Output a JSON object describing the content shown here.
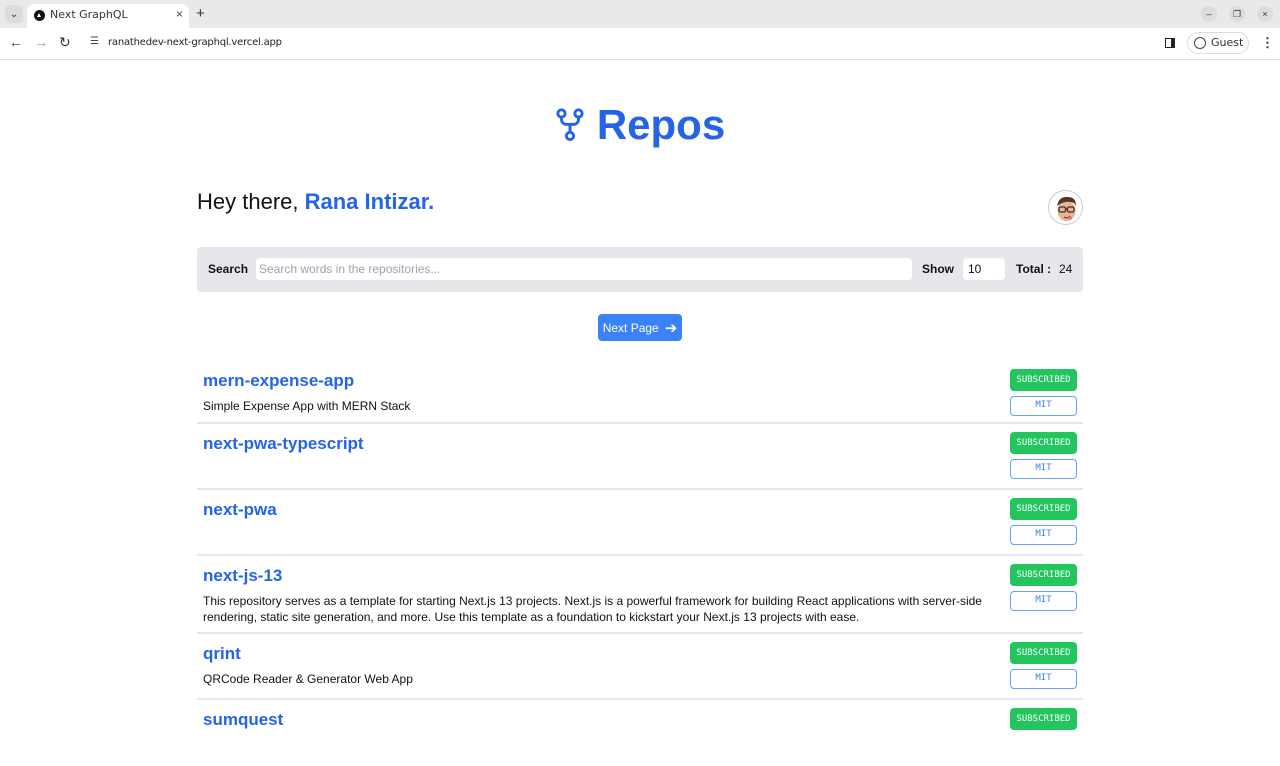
{
  "browser": {
    "tab_title": "Next GraphQL",
    "url": "ranathedev-next-graphql.vercel.app",
    "profile_label": "Guest"
  },
  "header": {
    "title": "Repos",
    "icon": "git-fork-icon",
    "brand_color": "#2563eb"
  },
  "greeting": {
    "prefix": "Hey there, ",
    "name": "Rana Intizar."
  },
  "search": {
    "label": "Search",
    "placeholder": "Search words in the repositories...",
    "value": "",
    "show_label": "Show",
    "show_value": "10",
    "total_label": "Total :",
    "total_value": "24"
  },
  "pagination": {
    "next_label": "Next Page",
    "next_icon": "arrow-right-icon"
  },
  "repos": [
    {
      "name": "mern-expense-app",
      "description": "Simple Expense App with MERN Stack",
      "status": "SUBSCRIBED",
      "license": "MIT"
    },
    {
      "name": "next-pwa-typescript",
      "description": "",
      "status": "SUBSCRIBED",
      "license": "MIT"
    },
    {
      "name": "next-pwa",
      "description": "",
      "status": "SUBSCRIBED",
      "license": "MIT"
    },
    {
      "name": "next-js-13",
      "description": "This repository serves as a template for starting Next.js 13 projects. Next.js is a powerful framework for building React applications with server-side rendering, static site generation, and more. Use this template as a foundation to kickstart your Next.js 13 projects with ease.",
      "status": "SUBSCRIBED",
      "license": "MIT"
    },
    {
      "name": "qrint",
      "description": "QRCode Reader & Generator Web App",
      "status": "SUBSCRIBED",
      "license": "MIT"
    },
    {
      "name": "sumquest",
      "description": "",
      "status": "SUBSCRIBED",
      "license": ""
    }
  ],
  "colors": {
    "subscribed": "#22c55e",
    "license_border": "#60a5fa",
    "search_bar_bg": "#e5e7eb",
    "button": "#3b82f6"
  }
}
